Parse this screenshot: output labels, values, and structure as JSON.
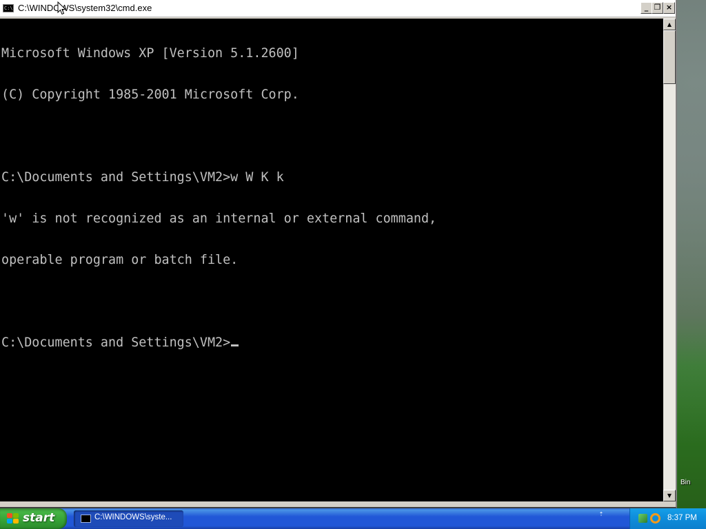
{
  "desktop": {
    "recycle_bin_partial_label": "Bin"
  },
  "window": {
    "title": "C:\\WINDOWS\\system32\\cmd.exe",
    "icon": "cmd-icon",
    "buttons": {
      "minimize": "_",
      "maximize": "❐",
      "close": "×"
    }
  },
  "console": {
    "lines": [
      "Microsoft Windows XP [Version 5.1.2600]",
      "(C) Copyright 1985-2001 Microsoft Corp.",
      "",
      "C:\\Documents and Settings\\VM2>w W K k",
      "'w' is not recognized as an internal or external command,",
      "operable program or batch file.",
      "",
      "C:\\Documents and Settings\\VM2>"
    ],
    "colors": {
      "background": "#000000",
      "text": "#c0c0c0"
    }
  },
  "scrollbar": {
    "up_arrow": "▲",
    "down_arrow": "▼"
  },
  "taskbar": {
    "start_label": "start",
    "tasks": [
      {
        "label": "C:\\WINDOWS\\syste...",
        "icon": "cmd-icon",
        "active": true
      }
    ],
    "tray_toggle": "⇡",
    "tray_icons": [
      "network-icon",
      "search-icon"
    ],
    "clock": "8:37 PM"
  }
}
